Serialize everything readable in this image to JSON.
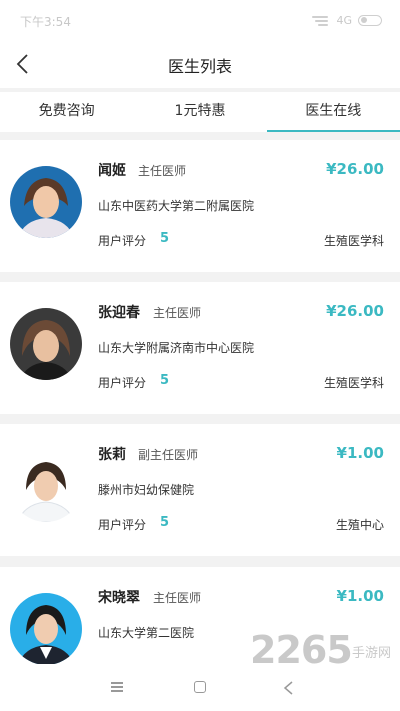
{
  "status_bar": {
    "time": "下午3:54",
    "network": "4G"
  },
  "header": {
    "title": "医生列表"
  },
  "tabs": [
    {
      "label": "免费咨询",
      "active": false
    },
    {
      "label": "1元特惠",
      "active": false
    },
    {
      "label": "医生在线",
      "active": true
    }
  ],
  "doctors": [
    {
      "name": "闻姬",
      "title": "主任医师",
      "price": "¥26.00",
      "hospital": "山东中医药大学第二附属医院",
      "rating_label": "用户评分",
      "rating": "5",
      "department": "生殖医学科"
    },
    {
      "name": "张迎春",
      "title": "主任医师",
      "price": "¥26.00",
      "hospital": "山东大学附属济南市中心医院",
      "rating_label": "用户评分",
      "rating": "5",
      "department": "生殖医学科"
    },
    {
      "name": "张莉",
      "title": "副主任医师",
      "price": "¥1.00",
      "hospital": "滕州市妇幼保健院",
      "rating_label": "用户评分",
      "rating": "5",
      "department": "生殖中心"
    },
    {
      "name": "宋晓翠",
      "title": "主任医师",
      "price": "¥1.00",
      "hospital": "山东大学第二医院",
      "rating_label": "",
      "rating": "",
      "department": ""
    }
  ],
  "watermark": {
    "text": "2265",
    "sub": "手游网"
  },
  "colors": {
    "accent": "#3bb9c2",
    "background": "#f2f2f2"
  }
}
